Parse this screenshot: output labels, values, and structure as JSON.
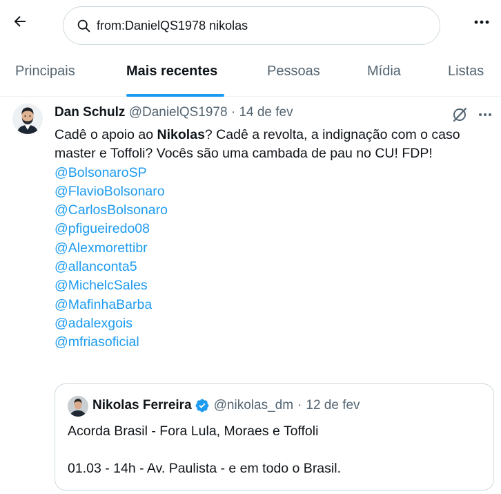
{
  "search": {
    "query": "from:DanielQS1978 nikolas",
    "icons": {
      "back": "arrow-left-icon",
      "search": "search-icon",
      "more": "more-horizontal-icon"
    }
  },
  "tabs": [
    {
      "label": "Principais"
    },
    {
      "label": "Mais recentes",
      "active": true
    },
    {
      "label": "Pessoas"
    },
    {
      "label": "Mídia"
    },
    {
      "label": "Listas"
    }
  ],
  "tweet": {
    "author_name": "Dan Schulz",
    "handle": "@DanielQS1978",
    "separator": "·",
    "date": "14 de fev",
    "text_before": "Cadê o apoio ao ",
    "highlight": "Nikolas",
    "text_after": "? Cadê  a revolta, a indignação com o caso master e Toffoli? Vocês são uma cambada de pau no CU! FDP!",
    "mentions": [
      "@BolsonaroSP",
      "@FlavioBolsonaro",
      "@CarlosBolsonaro",
      "@pfigueiredo08",
      "@Alexmorettibr",
      "@allanconta5",
      "@MichelcSales",
      "@MafinhaBarba",
      "@adalexgois",
      "@mfriasoficial"
    ]
  },
  "quote": {
    "author_name": "Nikolas Ferreira",
    "handle": "@nikolas_dm",
    "separator": "·",
    "date": "12 de fev",
    "line1": "Acorda Brasil - Fora Lula, Moraes e Toffoli",
    "line2": "01.03 - 14h - Av. Paulista - e em todo o Brasil."
  },
  "colors": {
    "accent": "#1d9bf0",
    "text": "#0f1419",
    "muted": "#536471",
    "border": "#cfd9de"
  }
}
